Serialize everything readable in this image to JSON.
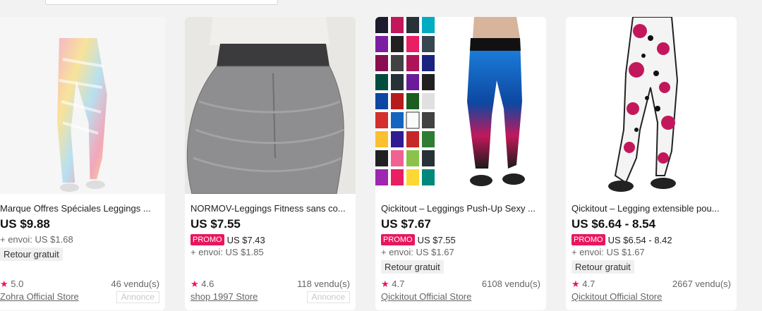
{
  "products": [
    {
      "title": "Marque Offres Spéciales Leggings ...",
      "price": "US $9.88",
      "promo_label": "",
      "promo_price": "",
      "shipping": "+ envoi: US $1.68",
      "free_return": "Retour gratuit",
      "rating": "5.0",
      "sold": "46 vendu(s)",
      "store": "Zohra Official Store",
      "ad_label": "Annonce"
    },
    {
      "title": "NORMOV-Leggings Fitness sans co...",
      "price": "US $7.55",
      "promo_label": "PROMO",
      "promo_price": "US $7.43",
      "shipping": "+ envoi: US $1.85",
      "free_return": "",
      "rating": "4.6",
      "sold": "118 vendu(s)",
      "store": "shop 1997 Store",
      "ad_label": "Annonce"
    },
    {
      "title": "Qickitout – Leggings Push-Up Sexy ...",
      "price": "US $7.67",
      "promo_label": "PROMO",
      "promo_price": "US $7.55",
      "shipping": "+ envoi: US $1.67",
      "free_return": "Retour gratuit",
      "rating": "4.7",
      "sold": "6108 vendu(s)",
      "store": "Qickitout Official Store",
      "ad_label": ""
    },
    {
      "title": "Qickitout – Legging extensible pou...",
      "price": "US $6.64 - 8.54",
      "promo_label": "PROMO",
      "promo_price": "US $6.54 - 8.42",
      "shipping": "+ envoi: US $1.67",
      "free_return": "Retour gratuit",
      "rating": "4.7",
      "sold": "2667 vendu(s)",
      "store": "Qickitout Official Store",
      "ad_label": ""
    }
  ],
  "colors": {
    "accent": "#e8175d",
    "text": "#222222",
    "muted": "#666666"
  },
  "icons": {
    "rating": "star-icon"
  }
}
